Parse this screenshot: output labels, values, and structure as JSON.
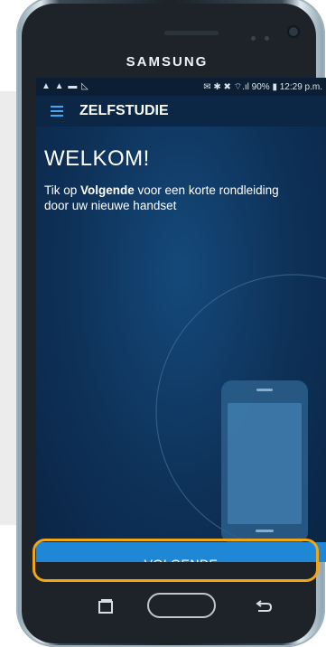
{
  "device": {
    "brand": "SAMSUNG"
  },
  "statusbar": {
    "left_icons": "▲ ▲ ▬ ◺",
    "right_text": "✉ ✱ ✖ ⌔.ıl 90% ▮ 12:29 p.m."
  },
  "appbar": {
    "menu_icon": "hamburger-icon",
    "title": "ZELFSTUDIE"
  },
  "content": {
    "heading": "WELKOM!",
    "intro_prefix": "Tik op ",
    "intro_bold": "Volgende",
    "intro_suffix": " voor een korte rondleiding door uw nieuwe handset"
  },
  "actions": {
    "next_label": "VOLGENDE"
  },
  "navbar": {
    "recent_icon": "recent-apps-icon",
    "home_icon": "home-button",
    "back_icon": "back-icon"
  },
  "colors": {
    "highlight": "#f2a516",
    "button": "#1e88d6",
    "screen_bg": "#0e3158",
    "accent": "#3fa9f5"
  }
}
